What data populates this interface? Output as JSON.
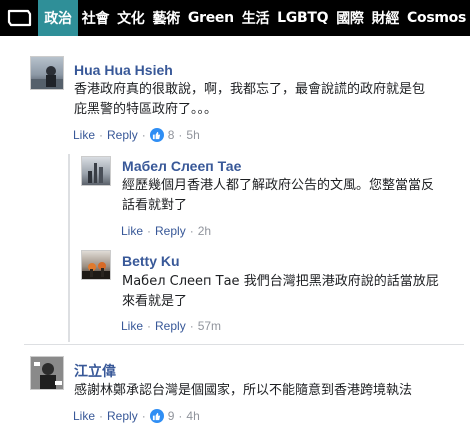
{
  "nav": {
    "items": [
      "政治",
      "社會",
      "文化",
      "藝術",
      "Green",
      "生活",
      "LGBTQ",
      "國際",
      "財經",
      "Cosmos"
    ],
    "active_index": 0
  },
  "comments": [
    {
      "author": "Hua Hua Hsieh",
      "text_line1": "香港政府真的很敢說，啊，我都忘了，最會說謊的政府就是包",
      "text_line2": "庇黑警的特區政府了。。。",
      "like_label": "Like",
      "reply_label": "Reply",
      "reactions": "8",
      "time": "5h"
    },
    {
      "author": "Мабел Слееп Тае",
      "text_line1": "經歷幾個月香港人都了解政府公告的文風。您整當當反",
      "text_line2": "話看就對了",
      "like_label": "Like",
      "reply_label": "Reply",
      "time": "2h"
    },
    {
      "author": "Betty Ku",
      "text_line1": "Мабел Слееп Тае 我們台灣把黑港政府說的話當放屁",
      "text_line2": "來看就是了",
      "like_label": "Like",
      "reply_label": "Reply",
      "time": "57m"
    },
    {
      "author": "江立偉",
      "text_line1": "感謝林鄭承認台灣是個國家，所以不能隨意到香港跨境執法",
      "like_label": "Like",
      "reply_label": "Reply",
      "reactions": "9",
      "time": "4h"
    }
  ],
  "colors": {
    "nav_bg": "#000000",
    "nav_active": "#2f8f98",
    "author_link": "#385898",
    "like_badge": "#2f8ef4"
  }
}
